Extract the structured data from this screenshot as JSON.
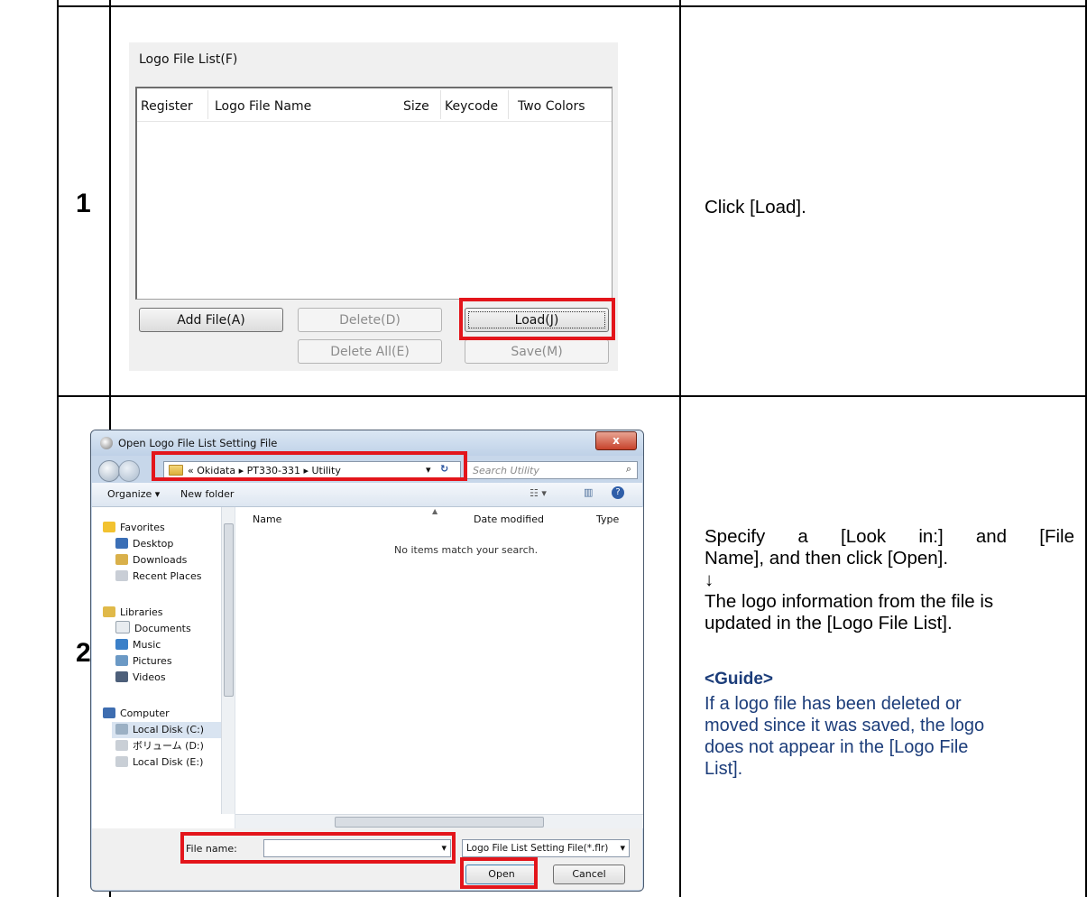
{
  "table": {
    "rows": [
      {
        "number": "1",
        "instruction": "Click [Load]."
      },
      {
        "number": "2",
        "instruction_lines": [
          "Specify a [Look in:] and [File",
          "Name], and then click [Open].",
          "↓",
          "The logo information from the file is",
          "updated in the [Logo File List]."
        ],
        "guide_title": "<Guide>",
        "guide_lines": [
          "If a logo file has been deleted or",
          "moved since it was saved, the logo",
          "does not appear in the [Logo File",
          "List]."
        ]
      }
    ]
  },
  "logo_panel": {
    "group_title": "Logo File List(F)",
    "columns": [
      "Register",
      "Logo File Name",
      "Size",
      "Keycode",
      "Two Colors"
    ],
    "buttons": {
      "add_file": "Add File(A)",
      "delete": "Delete(D)",
      "load": "Load(J)",
      "delete_all": "Delete All(E)",
      "save": "Save(M)"
    }
  },
  "open_dialog": {
    "title": "Open Logo File List Setting File",
    "close_label": "x",
    "breadcrumb": [
      "«",
      "Okidata",
      "▸",
      "PT330-331",
      "▸",
      "Utility"
    ],
    "search_placeholder": "Search Utility",
    "toolbar": {
      "organize": "Organize ▾",
      "new_folder": "New folder"
    },
    "nav": {
      "favorites": "Favorites",
      "desktop": "Desktop",
      "downloads": "Downloads",
      "recent_places": "Recent Places",
      "libraries": "Libraries",
      "documents": "Documents",
      "music": "Music",
      "pictures": "Pictures",
      "videos": "Videos",
      "computer": "Computer",
      "local_c": "Local Disk (C:)",
      "volume_d": "ボリューム (D:)",
      "local_e": "Local Disk (E:)"
    },
    "columns": {
      "name": "Name",
      "date_modified": "Date modified",
      "type": "Type"
    },
    "empty_message": "No items match your search.",
    "file_name_label": "File name:",
    "file_name_value": "",
    "filter": "Logo File List Setting File(*.flr)",
    "open_button": "Open",
    "cancel_button": "Cancel"
  },
  "colors": {
    "highlight_red": "#e3151b",
    "guide_blue": "#1c3d7a"
  }
}
